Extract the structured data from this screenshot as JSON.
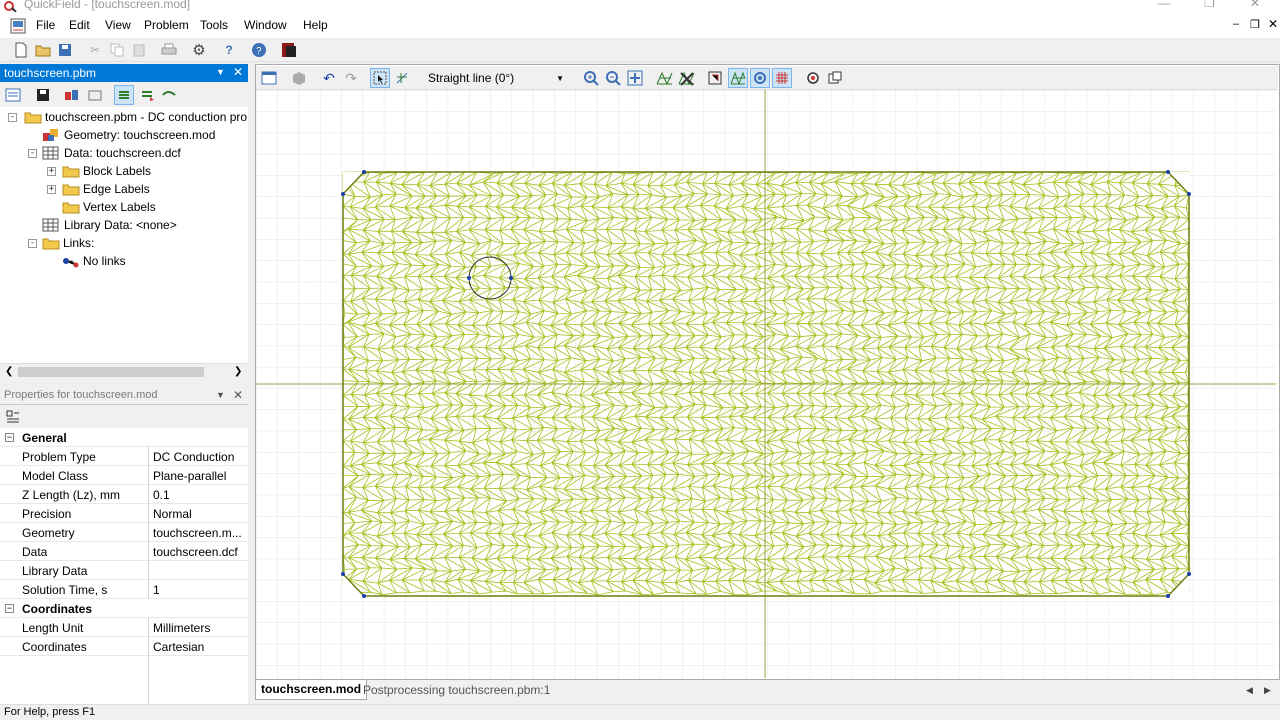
{
  "window": {
    "title": "QuickField - [touchscreen.mod]"
  },
  "menu": [
    "File",
    "Edit",
    "View",
    "Problem",
    "Tools",
    "Window",
    "Help"
  ],
  "problem_panel": {
    "title": "touchscreen.pbm",
    "tree": {
      "root": "touchscreen.pbm - DC conduction pro",
      "geometry": "Geometry: touchscreen.mod",
      "data": "Data: touchscreen.dcf",
      "block_labels": "Block Labels",
      "edge_labels": "Edge Labels",
      "vertex_labels": "Vertex Labels",
      "library": "Library Data: <none>",
      "links": "Links:",
      "no_links": "No links"
    }
  },
  "properties_panel": {
    "title": "Properties for touchscreen.mod",
    "cat_general": "General",
    "cat_coordinates": "Coordinates",
    "rows": [
      {
        "k": "Problem Type",
        "v": "DC Conduction"
      },
      {
        "k": "Model Class",
        "v": "Plane-parallel"
      },
      {
        "k": "Z Length (Lz), mm",
        "v": "0.1"
      },
      {
        "k": "Precision",
        "v": "Normal"
      },
      {
        "k": "Geometry",
        "v": "touchscreen.m..."
      },
      {
        "k": "Data",
        "v": "touchscreen.dcf"
      },
      {
        "k": "Library Data",
        "v": ""
      },
      {
        "k": "Solution Time, s",
        "v": "1"
      }
    ],
    "coord_rows": [
      {
        "k": "Length Unit",
        "v": "Millimeters"
      },
      {
        "k": "Coordinates",
        "v": "Cartesian"
      }
    ]
  },
  "view_toolbar": {
    "edge_mode": "Straight line (0°)"
  },
  "tabs": [
    "touchscreen.mod",
    "Postprocessing touchscreen.pbm:1"
  ],
  "status": "For Help, press F1",
  "colors": {
    "mesh": "#a6c11d",
    "accent": "#0078d7",
    "axis": "#9c9c3c"
  }
}
